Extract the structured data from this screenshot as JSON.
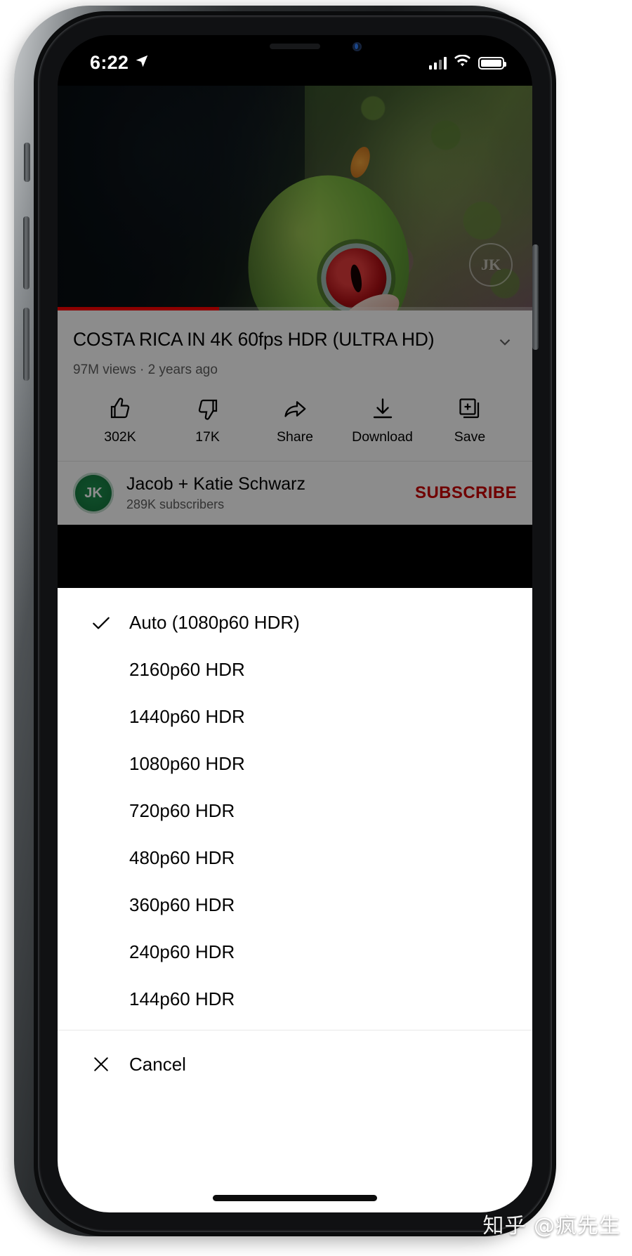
{
  "status_bar": {
    "time": "6:22",
    "location_icon": "location-arrow-icon",
    "cellular_icon": "cellular-bars-icon",
    "wifi_icon": "wifi-icon",
    "battery_icon": "battery-icon"
  },
  "video": {
    "watermark_text": "JK",
    "progress_percent": 34,
    "progress_color": "#ff0000"
  },
  "info": {
    "title": "COSTA RICA IN 4K 60fps HDR (ULTRA HD)",
    "meta": "97M views · 2 years ago",
    "collapse_icon": "chevron-down-icon",
    "actions": [
      {
        "icon": "thumbs-up-icon",
        "label": "302K"
      },
      {
        "icon": "thumbs-down-icon",
        "label": "17K"
      },
      {
        "icon": "share-icon",
        "label": "Share"
      },
      {
        "icon": "download-icon",
        "label": "Download"
      },
      {
        "icon": "save-to-playlist-icon",
        "label": "Save"
      }
    ],
    "channel": {
      "avatar_text": "JK",
      "name": "Jacob + Katie Schwarz",
      "subs": "289K subscribers",
      "subscribe_label": "SUBSCRIBE",
      "subscribe_color": "#cc0000"
    }
  },
  "quality_sheet": {
    "selected_index": 0,
    "check_icon": "checkmark-icon",
    "items": [
      {
        "label": "Auto (1080p60 HDR)",
        "selected": true
      },
      {
        "label": "2160p60 HDR",
        "selected": false
      },
      {
        "label": "1440p60 HDR",
        "selected": false
      },
      {
        "label": "1080p60 HDR",
        "selected": false
      },
      {
        "label": "720p60 HDR",
        "selected": false
      },
      {
        "label": "480p60 HDR",
        "selected": false
      },
      {
        "label": "360p60 HDR",
        "selected": false
      },
      {
        "label": "240p60 HDR",
        "selected": false
      },
      {
        "label": "144p60 HDR",
        "selected": false
      }
    ],
    "cancel": {
      "icon": "close-x-icon",
      "label": "Cancel"
    }
  },
  "overlay_watermark": "知乎 @疯先生"
}
